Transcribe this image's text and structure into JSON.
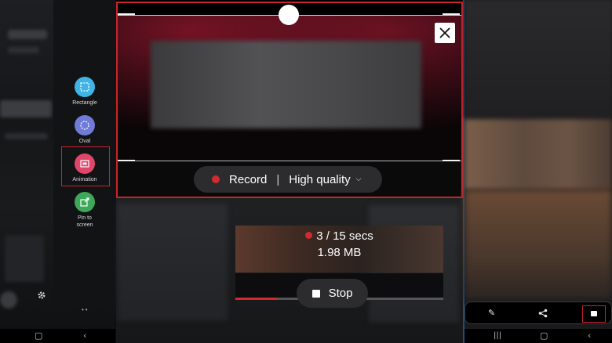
{
  "left_panel": {
    "tools": [
      {
        "label": "Rectangle",
        "icon": "rectangle-select-icon",
        "color": "#3fb4e6"
      },
      {
        "label": "Oval",
        "icon": "oval-select-icon",
        "color": "#6f7bd6"
      },
      {
        "label": "Animation",
        "icon": "animation-gif-icon",
        "color": "#e0466a"
      },
      {
        "label": "Pin to\nscreen",
        "icon": "pin-to-screen-icon",
        "color": "#3ea85a"
      }
    ],
    "settings_icon": "gear-icon",
    "highlight_color": "#c8242c"
  },
  "capture": {
    "record_label": "Record",
    "separator": "|",
    "quality_label": "High quality",
    "quality_icon": "chevron-down-icon",
    "close_icon": "close-icon",
    "accent": "#d22a2f"
  },
  "recording": {
    "progress_text": "3 / 15 secs",
    "size_text": "1.98 MB",
    "stop_label": "Stop",
    "progress_fraction": 0.2
  },
  "right_panel": {
    "toolbar_icons": [
      "edit-pencil-icon",
      "share-icon",
      "save-download-icon"
    ]
  },
  "nav": {
    "left": [
      "home-icon",
      "back-icon"
    ],
    "right": [
      "recents-icon",
      "home-icon",
      "back-icon"
    ]
  }
}
